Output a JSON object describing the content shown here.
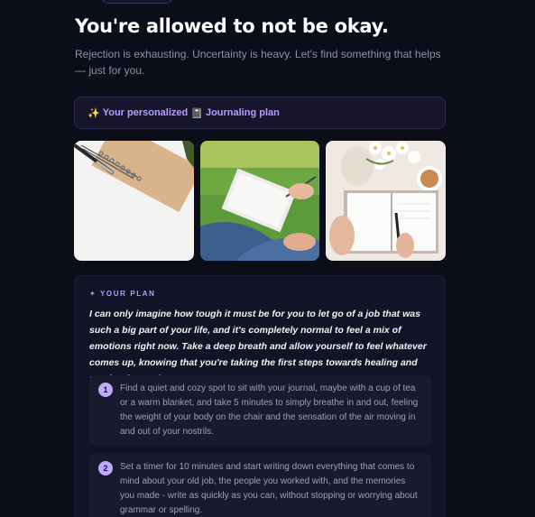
{
  "header": {
    "title": "You're allowed to not be okay.",
    "subtitle": "Rejection is exhausting. Uncertainty is heavy. Let's find something that helps — just for you."
  },
  "banner": {
    "sparkle_icon": "✨",
    "text_before": "Your personalized",
    "notebook_icon": "📓",
    "text_after": "Journaling plan"
  },
  "images": [
    {
      "icon": "notebook-pen-photo",
      "alt": "Spiral notebook with pen"
    },
    {
      "icon": "writing-outdoors-photo",
      "alt": "Person writing in notebook on grass"
    },
    {
      "icon": "journal-flowers-photo",
      "alt": "Open journal with flowers and tea"
    }
  ],
  "plan": {
    "label": "✦ YOUR PLAN",
    "intro": "I can only imagine how tough it must be for you to let go of a job that was such a big part of your life, and it's completely normal to feel a mix of emotions right now. Take a deep breath and allow yourself to feel whatever comes up, knowing that you're taking the first steps towards healing and moving forward.",
    "steps": [
      {
        "num": "1",
        "text": "Find a quiet and cozy spot to sit with your journal, maybe with a cup of tea or a warm blanket, and take 5 minutes to simply breathe in and out, feeling the weight of your body on the chair and the sensation of the air moving in and out of your nostrils."
      },
      {
        "num": "2",
        "text": "Set a timer for 10 minutes and start writing down everything that comes to mind about your old job, the people you worked with, and the memories you made - write as quickly as you can, without stopping or worrying about grammar or spelling."
      }
    ]
  },
  "colors": {
    "background": "#0b0d19",
    "accent": "#b89cff",
    "card": "#111426"
  }
}
